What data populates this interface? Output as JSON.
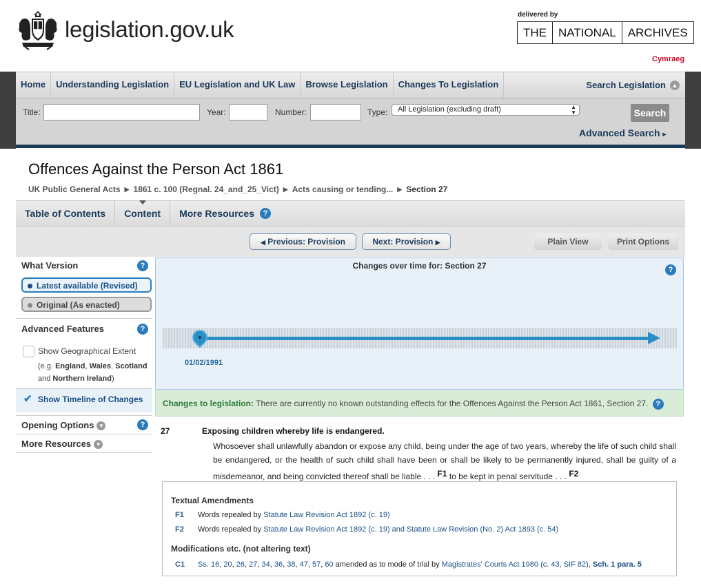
{
  "header": {
    "site_name": "legislation.gov.uk",
    "delivered_by": "delivered by",
    "archives": [
      "THE",
      "NATIONAL",
      "ARCHIVES"
    ],
    "language_link": "Cymraeg"
  },
  "nav": {
    "items": [
      "Home",
      "Understanding Legislation",
      "EU Legislation and UK Law",
      "Browse Legislation",
      "Changes To Legislation"
    ],
    "search_link": "Search Legislation"
  },
  "search": {
    "title_label": "Title:",
    "title_value": "",
    "year_label": "Year:",
    "year_value": "",
    "number_label": "Number:",
    "number_value": "",
    "type_label": "Type:",
    "type_value": "All Legislation (excluding draft)",
    "search_button": "Search",
    "advanced_link": "Advanced Search"
  },
  "page": {
    "title": "Offences Against the Person Act 1861",
    "breadcrumb": [
      "UK Public General Acts",
      "1861 c. 100 (Regnal. 24_and_25_Vict)",
      "Acts causing or tending...",
      "Section 27"
    ]
  },
  "tabs": [
    "Table of Contents",
    "Content",
    "More Resources"
  ],
  "provision_nav": {
    "previous": "Previous: Provision",
    "next": "Next: Provision",
    "plain_view": "Plain View",
    "print_options": "Print Options"
  },
  "sidebar": {
    "what_version": "What Version",
    "latest": "Latest available (Revised)",
    "original": "Original (As enacted)",
    "advanced_features": "Advanced Features",
    "show_geo": "Show Geographical Extent",
    "geo_note_1": "(e.g. ",
    "geo_england": "England",
    "geo_comma1": ", ",
    "geo_wales": "Wales",
    "geo_comma2": ", ",
    "geo_scotland": "Scotland",
    "geo_and": "and ",
    "geo_ni": "Northern Ireland",
    "geo_close": ")",
    "show_timeline": "Show Timeline of Changes",
    "opening_options": "Opening Options",
    "more_resources": "More Resources"
  },
  "timeline": {
    "title": "Changes over time for: Section 27",
    "date": "01/02/1991"
  },
  "changes": {
    "label": "Changes to legislation:",
    "text": "There are currently no known outstanding effects for the Offences Against the Person Act 1861, Section 27."
  },
  "section": {
    "number": "27",
    "title": "Exposing children whereby life is endangered.",
    "body": "Whosoever shall unlawfully abandon or expose any child, being under the age of two years, whereby the life of such child shall be endangered, or the health of such child shall have been or shall be likely to be permanently injured, shall be guilty of a misdemeanor, and being convicted thereof shall be liable . . . ",
    "f1": "F1",
    "body_2": " to be kept in penal servitude . . . ",
    "f2": "F2"
  },
  "annotations": {
    "textual_heading": "Textual Amendments",
    "f1_key": "F1",
    "f1_text": "Words repealed by ",
    "f1_link": "Statute Law Revision Act 1892 (c. 19)",
    "f2_key": "F2",
    "f2_text": "Words repealed by ",
    "f2_link": "Statute Law Revision Act 1892 (c. 19) and Statute Law Revision (No. 2) Act 1893 (c. 54)",
    "mods_heading": "Modifications etc. (not altering text)",
    "c1_key": "C1",
    "c1_prefix": "Ss. ",
    "c1_sections": [
      "16",
      "20",
      "26",
      "27",
      "34",
      "36",
      "38",
      "47",
      "57",
      "60"
    ],
    "c1_text": " amended as to mode of trial by ",
    "c1_link": "Magistrates' Courts Act 1980 (c. 43, SIF 82)",
    "c1_comma": ", ",
    "c1_sch": "Sch. 1 para. 5"
  },
  "colors": {
    "navy": "#1a3a5a",
    "link_blue": "#1a4f86",
    "help_blue": "#2a7bbd",
    "timeline_blue": "#2a8fc4",
    "cymraeg_red": "#c8102e",
    "changes_green": "#2f7a3a"
  }
}
